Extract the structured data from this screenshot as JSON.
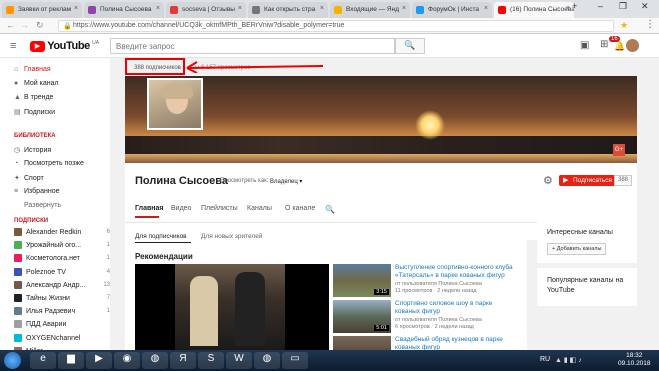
{
  "browser": {
    "tabs": [
      {
        "label": "Заявки от реклам",
        "color": "#ff9800"
      },
      {
        "label": "Полина Сысоева",
        "color": "#8e44ad"
      },
      {
        "label": "socseva | Отзывы",
        "color": "#e53935"
      },
      {
        "label": "Как открыть стра",
        "color": "#757575"
      },
      {
        "label": "Входящие — Янд",
        "color": "#f4b400"
      },
      {
        "label": "ФорумОк | Инста",
        "color": "#2196f3"
      },
      {
        "label": "(16) Полина Сысоева",
        "color": "#ff0000"
      }
    ],
    "url": "https://www.youtube.com/channel/UCQ3k_okmfMPth_BERrVniw?disable_polymer=true",
    "minimize": "–",
    "maximize": "❐",
    "close": "✕",
    "new_tab": "+"
  },
  "youtube": {
    "logo_text": "YouTube",
    "logo_region": "UA",
    "search_placeholder": "Введите запрос",
    "notif_count": "16"
  },
  "sidebar": {
    "main_items": [
      {
        "label": "Главная",
        "icon": "home-icon",
        "glyph": "⌂"
      },
      {
        "label": "Мой канал",
        "icon": "user-icon",
        "glyph": "●"
      },
      {
        "label": "В тренде",
        "icon": "flame-icon",
        "glyph": "▲"
      },
      {
        "label": "Подписки",
        "icon": "subscriptions-icon",
        "glyph": "▤"
      }
    ],
    "library_header": "БИБЛИОТЕКА",
    "library_items": [
      {
        "label": "История",
        "icon": "history-icon",
        "glyph": "◷"
      },
      {
        "label": "Посмотреть позже",
        "icon": "clock-icon",
        "glyph": "◔"
      },
      {
        "label": "Спорт",
        "icon": "trophy-icon",
        "glyph": "✦"
      },
      {
        "label": "Избранное",
        "icon": "playlist-icon",
        "glyph": "≡"
      }
    ],
    "expand": "Развернуть",
    "subs_header": "ПОДПИСКИ",
    "subs": [
      {
        "label": "Alexander Redkin",
        "count": "6",
        "color": "#7b5a3c"
      },
      {
        "label": "Урожайный ого...",
        "count": "1",
        "color": "#4caf50"
      },
      {
        "label": "Косметолога.нет",
        "count": "1",
        "color": "#e91e63"
      },
      {
        "label": "Poleznoe TV",
        "count": "4",
        "color": "#3f51b5"
      },
      {
        "label": "Александр Андр...",
        "count": "13",
        "color": "#795548"
      },
      {
        "label": "Тайны Жизни",
        "count": "7",
        "color": "#212121"
      },
      {
        "label": "Илья Радзевич",
        "count": "1",
        "color": "#607d8b"
      },
      {
        "label": "ПДД Аварии",
        "count": "",
        "color": "#9e9e9e"
      },
      {
        "label": "OXYGENchannel",
        "count": "",
        "color": "#00bcd4"
      },
      {
        "label": "Miller...",
        "count": "",
        "color": "#8d6e63"
      }
    ]
  },
  "channel": {
    "subs_label": "388 подписчиков",
    "views_label": "ы 6 157 просмотров",
    "name": "Полина Сысоева",
    "view_as_label": "Просмотреть как:",
    "view_as_value": "Владелец",
    "subscribe_label": "Подписаться",
    "subscribe_count": "388",
    "tabs": [
      "Главная",
      "Видео",
      "Плейлисты",
      "Каналы",
      "О канале"
    ],
    "subtabs": [
      "Для подписчиков",
      "Для новых зрителей"
    ],
    "recs_title": "Рекомендации",
    "videos": [
      {
        "title": "Выступление спортивно-конного клуба «Татерсаль» в парке кованых фигур",
        "by": "от пользователя Полина Сысоева",
        "meta": "11 просмотров · 2 недели назад",
        "duration": "3:15"
      },
      {
        "title": "Спортивно силовое шоу в парке кованых фигур",
        "by": "от пользователя Полина Сысоева",
        "meta": "6 просмотров · 2 недели назад",
        "duration": "5:01"
      },
      {
        "title": "Свадебный обряд кузнецов в парке кованых фигур",
        "by": "",
        "meta": "",
        "duration": ""
      }
    ]
  },
  "right_panel": {
    "interesting_title": "Интересные каналы",
    "add_channels": "+ Добавить каналы",
    "popular_title": "Популярные каналы на YouTube"
  },
  "taskbar": {
    "lang": "RU",
    "time": "18:32",
    "date": "09.10.2018"
  }
}
